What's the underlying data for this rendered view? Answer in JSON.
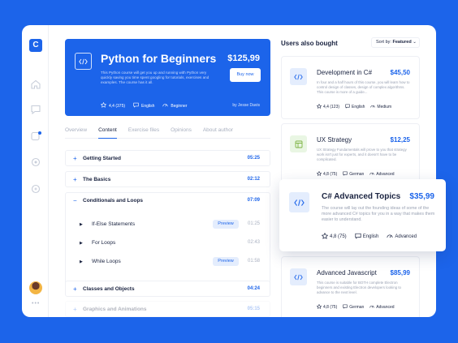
{
  "sidebar": {
    "logo": "C",
    "icons": [
      "home-icon",
      "chat-icon",
      "messages-icon",
      "location-icon",
      "settings-icon"
    ]
  },
  "hero": {
    "title": "Python for Beginners",
    "price": "$125,99",
    "description": "This Python course will get you up and running with Python very quickly saving you time spent googling for tutorials, exercises and examples. The course has it all.",
    "buy_label": "Buy now",
    "rating": "4,4 (375)",
    "language": "English",
    "level": "Beginner",
    "author": "by Jesse Davis"
  },
  "tabs": [
    {
      "label": "Overview"
    },
    {
      "label": "Content"
    },
    {
      "label": "Exercise files"
    },
    {
      "label": "Opinions"
    },
    {
      "label": "About author"
    }
  ],
  "content": {
    "sections": [
      {
        "sign": "+",
        "title": "Getting Started",
        "time": "05:25"
      },
      {
        "sign": "+",
        "title": "The Basics",
        "time": "02:12"
      },
      {
        "sign": "−",
        "title": "Conditionals and Loops",
        "time": "07:09"
      },
      {
        "sign": "+",
        "title": "Classes and Objects",
        "time": "04:24"
      },
      {
        "sign": "+",
        "title": "Graphics and Animations",
        "time": "05:15"
      }
    ],
    "lessons": [
      {
        "title": "If-Else Statements",
        "preview": "Preview",
        "time": "01:25"
      },
      {
        "title": "For Loops",
        "preview": "",
        "time": "02:43"
      },
      {
        "title": "While Loops",
        "preview": "Preview",
        "time": "01:58"
      }
    ]
  },
  "right": {
    "heading": "Users also bought",
    "sort_label": "Sort by:",
    "sort_value": "Featured",
    "cards": [
      {
        "title": "Development in C#",
        "price": "$45,50",
        "description": "In four and a half hours of this course, you will learn how to control design of classes, design of complex algorithms. This course is more of a guide...",
        "rating": "4,4 (123)",
        "language": "English",
        "level": "Medium",
        "icon_color": "#e4edfd"
      },
      {
        "title": "UX Strategy",
        "price": "$12,25",
        "description": "UX Strategy Fundamentals will prove to you that strategy work isn't just for experts, and it doesn't have to be complicated.",
        "rating": "4,8 (75)",
        "language": "German",
        "level": "Advanced",
        "icon_color": "#e9f6e3"
      },
      {
        "title": "C# Advanced Topics",
        "price": "$35,99",
        "description": "The course will lay out the founding ideas of some of the more advanced C# topics for you in a way that makes them easier to understand.",
        "rating": "4,8 (75)",
        "language": "English",
        "level": "Advanced",
        "icon_color": "#e4edfd"
      },
      {
        "title": "Advanced Javascript",
        "price": "$85,99",
        "description": "This course is suitable for BOTH complete Electron beginners and existing Electron developers looking to advance to the next level.",
        "rating": "4,8 (75)",
        "language": "German",
        "level": "Advanced",
        "icon_color": "#e4edfd"
      }
    ]
  },
  "colors": {
    "accent": "#1c64ea",
    "text": "#1a2340",
    "muted": "#a9b0c0"
  }
}
